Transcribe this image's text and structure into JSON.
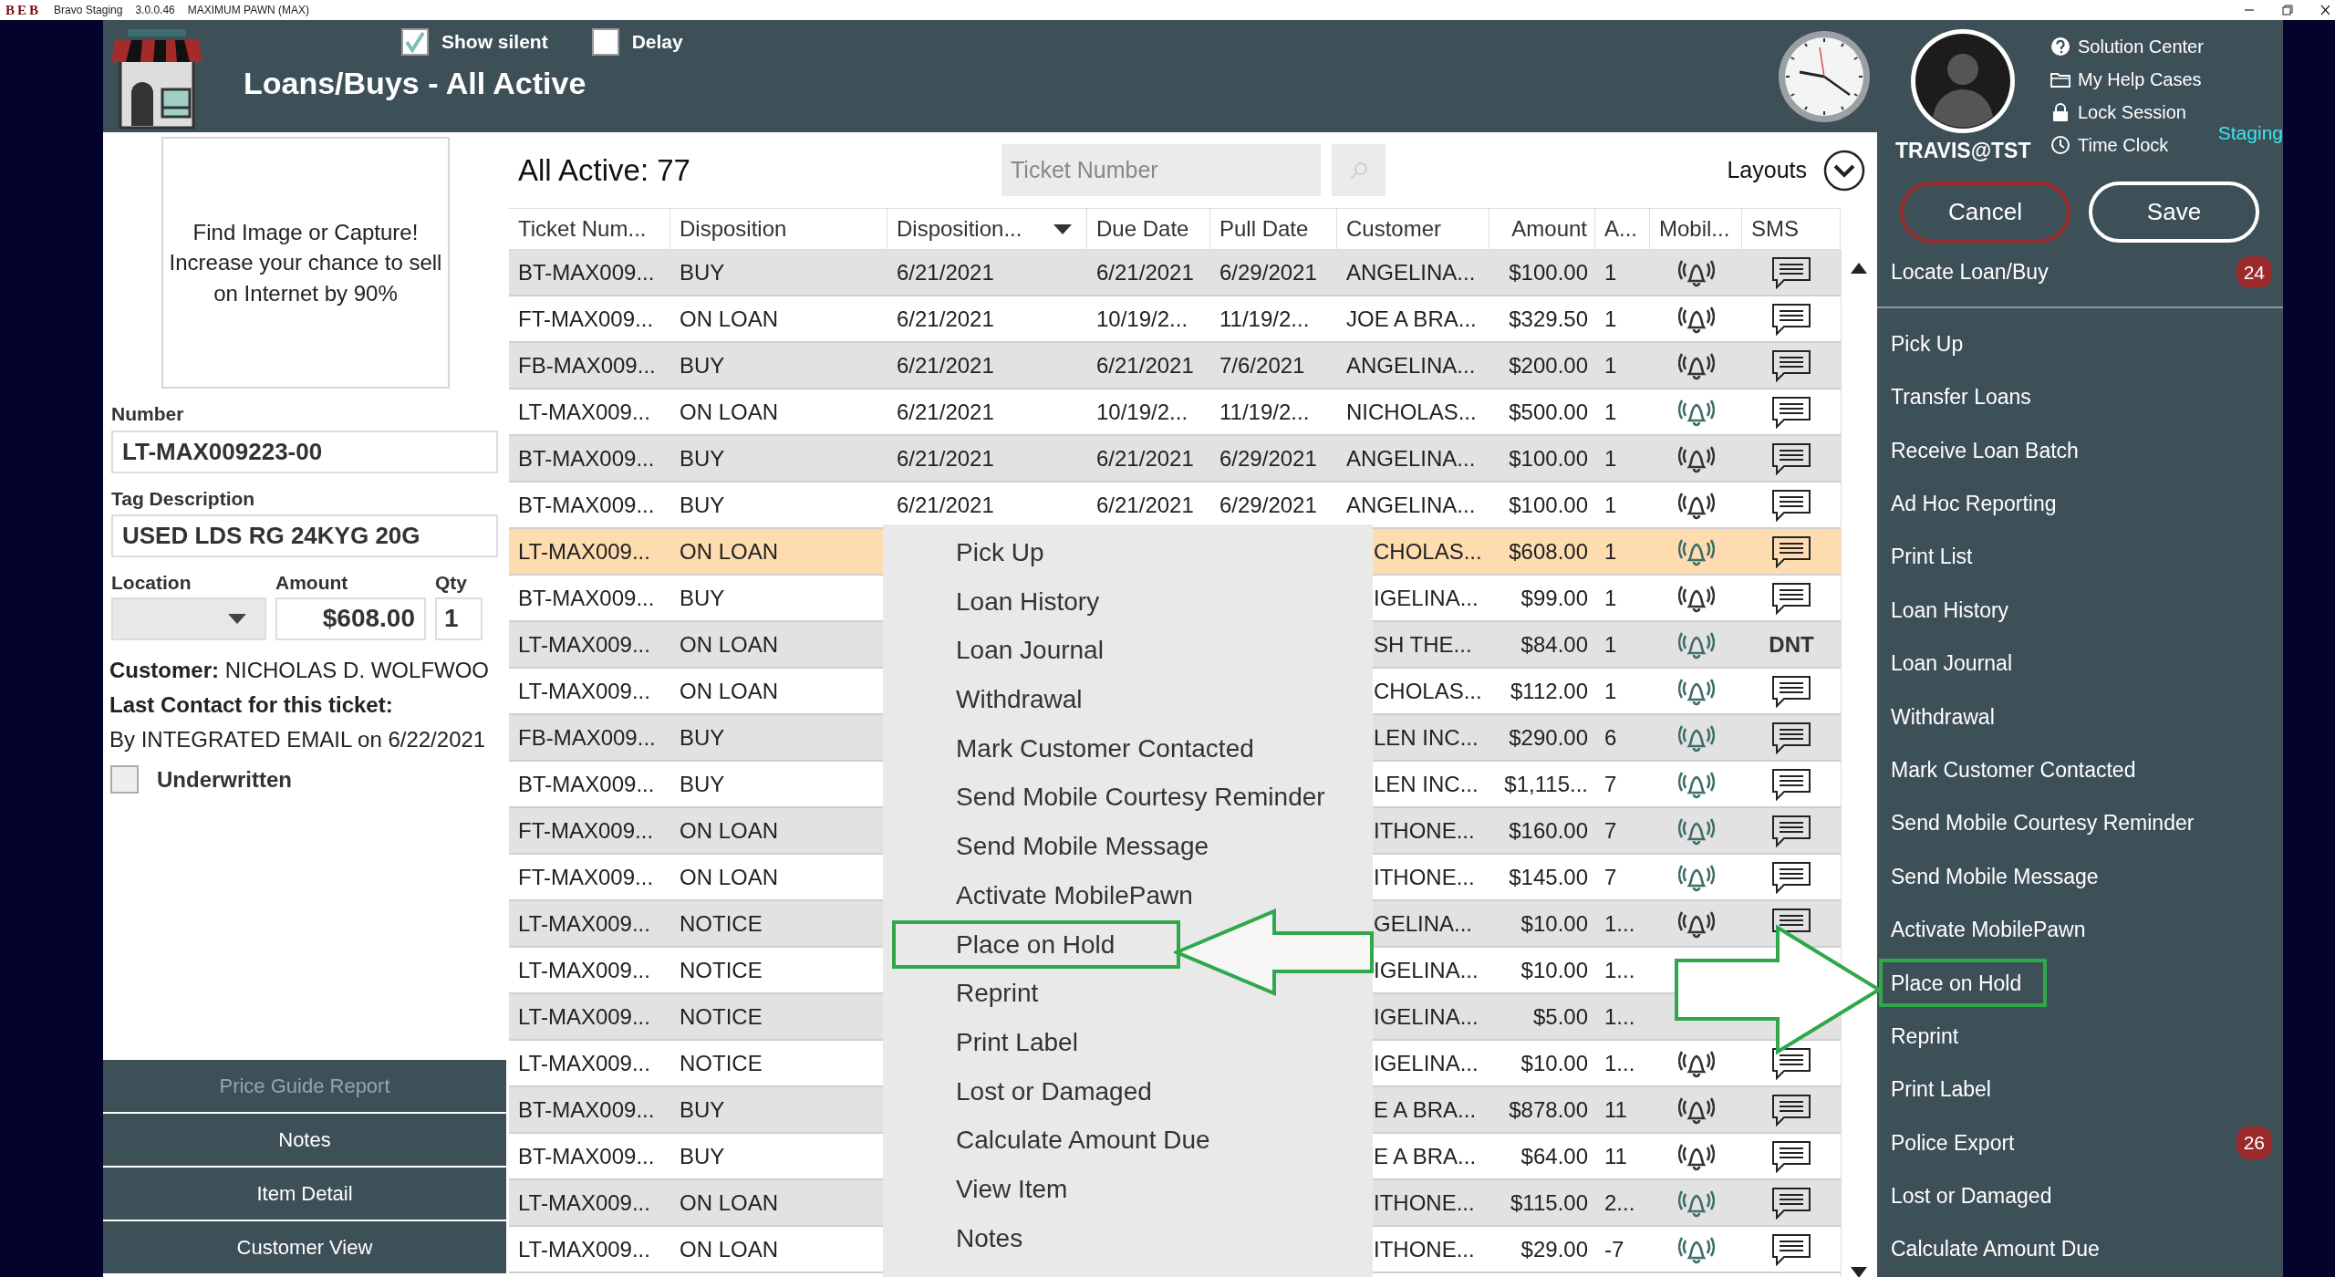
{
  "title_bar": {
    "logo": "BEB",
    "app": "Bravo Staging",
    "version": "3.0.0.46",
    "store": "MAXIMUM PAWN (MAX)"
  },
  "header": {
    "title": "Loans/Buys - All Active",
    "checkboxes": [
      {
        "label": "Show silent",
        "checked": true
      },
      {
        "label": "Delay",
        "checked": false
      }
    ]
  },
  "user": {
    "name": "TRAVIS@TST",
    "environment": "Staging",
    "links": [
      {
        "label": "Solution Center"
      },
      {
        "label": "My Help Cases"
      },
      {
        "label": "Lock Session"
      },
      {
        "label": "Time Clock"
      }
    ]
  },
  "detail": {
    "image_prompt": "Find Image or Capture!\nIncrease your chance to sell\non Internet by 90%",
    "number_label": "Number",
    "number": "LT-MAX009223-00",
    "tag_label": "Tag Description",
    "tag": "USED LDS RG 24KYG 20G",
    "location_label": "Location",
    "amount_label": "Amount",
    "amount": "$608.00",
    "qty_label": "Qty",
    "qty": "1",
    "customer": "**Customer:** NICHOLAS D. WOLFWOO",
    "last_contact_label": "Last Contact for this ticket:",
    "last_contact": "By INTEGRATED EMAIL on 6/22/2021",
    "underwritten": {
      "label": "Underwritten",
      "checked": false
    }
  },
  "detail_buttons": [
    {
      "label": "Price Guide Report",
      "disabled": true
    },
    {
      "label": "Notes",
      "disabled": false
    },
    {
      "label": "Item Detail",
      "disabled": false
    },
    {
      "label": "Customer View",
      "disabled": false
    }
  ],
  "list": {
    "title": "All Active: 77",
    "search_placeholder": "Ticket Number",
    "layouts_label": "Layouts"
  },
  "table": {
    "columns": [
      {
        "label": "Ticket Num..."
      },
      {
        "label": "Disposition"
      },
      {
        "label": "Disposition...",
        "sorted": true
      },
      {
        "label": "Due Date"
      },
      {
        "label": "Pull Date"
      },
      {
        "label": "Customer"
      },
      {
        "label": "Amount"
      },
      {
        "label": "A..."
      },
      {
        "label": "Mobil..."
      },
      {
        "label": "SMS"
      }
    ],
    "rows": [
      {
        "ticket": "BT-MAX009...",
        "disposition": "BUY",
        "disposition_date": "6/21/2021",
        "due_date": "6/21/2021",
        "pull_date": "6/29/2021",
        "customer": "ANGELINA...",
        "amount": "$100.00",
        "a": "1",
        "mobile": {
          "color": "#333333"
        },
        "sms": {
          "kind": "icon"
        },
        "selected": false
      },
      {
        "ticket": "FT-MAX009...",
        "disposition": "ON LOAN",
        "disposition_date": "6/21/2021",
        "due_date": "10/19/2...",
        "pull_date": "11/19/2...",
        "customer": "JOE A BRA...",
        "amount": "$329.50",
        "a": "1",
        "mobile": {
          "color": "#333333"
        },
        "sms": {
          "kind": "icon"
        },
        "selected": false
      },
      {
        "ticket": "FB-MAX009...",
        "disposition": "BUY",
        "disposition_date": "6/21/2021",
        "due_date": "6/21/2021",
        "pull_date": "7/6/2021",
        "customer": "ANGELINA...",
        "amount": "$200.00",
        "a": "1",
        "mobile": {
          "color": "#333333"
        },
        "sms": {
          "kind": "icon"
        },
        "selected": false
      },
      {
        "ticket": "LT-MAX009...",
        "disposition": "ON LOAN",
        "disposition_date": "6/21/2021",
        "due_date": "10/19/2...",
        "pull_date": "11/19/2...",
        "customer": "NICHOLAS...",
        "amount": "$500.00",
        "a": "1",
        "mobile": {
          "color": "#3e6e68"
        },
        "sms": {
          "kind": "icon"
        },
        "selected": false
      },
      {
        "ticket": "BT-MAX009...",
        "disposition": "BUY",
        "disposition_date": "6/21/2021",
        "due_date": "6/21/2021",
        "pull_date": "6/29/2021",
        "customer": "ANGELINA...",
        "amount": "$100.00",
        "a": "1",
        "mobile": {
          "color": "#333333"
        },
        "sms": {
          "kind": "icon"
        },
        "selected": false
      },
      {
        "ticket": "BT-MAX009...",
        "disposition": "BUY",
        "disposition_date": "6/21/2021",
        "due_date": "6/21/2021",
        "pull_date": "6/29/2021",
        "customer": "ANGELINA...",
        "amount": "$100.00",
        "a": "1",
        "mobile": {
          "color": "#333333"
        },
        "sms": {
          "kind": "icon"
        },
        "selected": false
      },
      {
        "ticket": "LT-MAX009...",
        "disposition": "ON LOAN",
        "customer": "CHOLAS...",
        "amount": "$608.00",
        "a": "1",
        "mobile": {
          "color": "#3e6e68"
        },
        "sms": {
          "kind": "icon"
        },
        "selected": true
      },
      {
        "ticket": "BT-MAX009...",
        "disposition": "BUY",
        "customer": "IGELINA...",
        "amount": "$99.00",
        "a": "1",
        "mobile": {
          "color": "#333333"
        },
        "sms": {
          "kind": "icon"
        },
        "selected": false
      },
      {
        "ticket": "LT-MAX009...",
        "disposition": "ON LOAN",
        "customer": "SH THE...",
        "amount": "$84.00",
        "a": "1",
        "mobile": {
          "color": "#3e6e68"
        },
        "sms": {
          "kind": "text",
          "text": "DNT"
        },
        "selected": false
      },
      {
        "ticket": "LT-MAX009...",
        "disposition": "ON LOAN",
        "customer": "CHOLAS...",
        "amount": "$112.00",
        "a": "1",
        "mobile": {
          "color": "#3e6e68"
        },
        "sms": {
          "kind": "icon"
        },
        "selected": false
      },
      {
        "ticket": "FB-MAX009...",
        "disposition": "BUY",
        "customer": "LEN INC...",
        "amount": "$290.00",
        "a": "6",
        "mobile": {
          "color": "#3e6e68"
        },
        "sms": {
          "kind": "icon"
        },
        "selected": false
      },
      {
        "ticket": "BT-MAX009...",
        "disposition": "BUY",
        "customer": "LEN INC...",
        "amount": "$1,115...",
        "a": "7",
        "mobile": {
          "color": "#3e6e68"
        },
        "sms": {
          "kind": "icon"
        },
        "selected": false
      },
      {
        "ticket": "FT-MAX009...",
        "disposition": "ON LOAN",
        "customer": "ITHONE...",
        "amount": "$160.00",
        "a": "7",
        "mobile": {
          "color": "#3e6e68"
        },
        "sms": {
          "kind": "icon"
        },
        "selected": false
      },
      {
        "ticket": "FT-MAX009...",
        "disposition": "ON LOAN",
        "customer": "ITHONE...",
        "amount": "$145.00",
        "a": "7",
        "mobile": {
          "color": "#3e6e68"
        },
        "sms": {
          "kind": "icon"
        },
        "selected": false
      },
      {
        "ticket": "LT-MAX009...",
        "disposition": "NOTICE",
        "customer": "GELINA...",
        "amount": "$10.00",
        "a": "1...",
        "mobile": {
          "color": "#333333"
        },
        "sms": {
          "kind": "icon"
        },
        "selected": false
      },
      {
        "ticket": "LT-MAX009...",
        "disposition": "NOTICE",
        "customer": "IGELINA...",
        "amount": "$10.00",
        "a": "1...",
        "selected": false
      },
      {
        "ticket": "LT-MAX009...",
        "disposition": "NOTICE",
        "customer": "IGELINA...",
        "amount": "$5.00",
        "a": "1...",
        "selected": false
      },
      {
        "ticket": "LT-MAX009...",
        "disposition": "NOTICE",
        "customer": "IGELINA...",
        "amount": "$10.00",
        "a": "1...",
        "mobile": {
          "color": "#333333"
        },
        "sms": {
          "kind": "icon"
        },
        "selected": false
      },
      {
        "ticket": "BT-MAX009...",
        "disposition": "BUY",
        "customer": "E A BRA...",
        "amount": "$878.00",
        "a": "11",
        "mobile": {
          "color": "#333333"
        },
        "sms": {
          "kind": "icon"
        },
        "selected": false
      },
      {
        "ticket": "BT-MAX009...",
        "disposition": "BUY",
        "customer": "E A BRA...",
        "amount": "$64.00",
        "a": "11",
        "mobile": {
          "color": "#333333"
        },
        "sms": {
          "kind": "icon"
        },
        "selected": false
      },
      {
        "ticket": "LT-MAX009...",
        "disposition": "ON LOAN",
        "customer": "ITHONE...",
        "amount": "$115.00",
        "a": "2...",
        "mobile": {
          "color": "#3e6e68"
        },
        "sms": {
          "kind": "icon"
        },
        "selected": false
      },
      {
        "ticket": "LT-MAX009...",
        "disposition": "ON LOAN",
        "customer": "ITHONE...",
        "amount": "$29.00",
        "a": "-7",
        "mobile": {
          "color": "#3e6e68"
        },
        "sms": {
          "kind": "icon"
        },
        "selected": false
      }
    ]
  },
  "context_menu": [
    {
      "label": "Pick Up",
      "annotated": false
    },
    {
      "label": "Loan History",
      "annotated": false
    },
    {
      "label": "Loan Journal",
      "annotated": false
    },
    {
      "label": "Withdrawal",
      "annotated": false
    },
    {
      "label": "Mark Customer Contacted",
      "annotated": false
    },
    {
      "label": "Send Mobile Courtesy Reminder",
      "annotated": false
    },
    {
      "label": "Send Mobile Message",
      "annotated": false
    },
    {
      "label": "Activate MobilePawn",
      "annotated": false
    },
    {
      "label": "Place on Hold",
      "annotated": true
    },
    {
      "label": "Reprint",
      "annotated": false
    },
    {
      "label": "Print Label",
      "annotated": false
    },
    {
      "label": "Lost or Damaged",
      "annotated": false
    },
    {
      "label": "Calculate Amount Due",
      "annotated": false
    },
    {
      "label": "View Item",
      "annotated": false
    },
    {
      "label": "Notes",
      "annotated": false
    }
  ],
  "callout_arrows": [
    {
      "kind": "left"
    },
    {
      "kind": "right"
    }
  ],
  "sidebar": {
    "cancel": "Cancel",
    "save": "Save",
    "locate": {
      "label": "Locate Loan/Buy",
      "badge": "24"
    },
    "items": [
      {
        "label": "Pick Up",
        "annotated": false
      },
      {
        "label": "Transfer Loans",
        "annotated": false
      },
      {
        "label": "Receive Loan Batch",
        "annotated": false
      },
      {
        "label": "Ad Hoc Reporting",
        "annotated": false
      },
      {
        "label": "Print List",
        "annotated": false
      },
      {
        "label": "Loan History",
        "annotated": false
      },
      {
        "label": "Loan Journal",
        "annotated": false
      },
      {
        "label": "Withdrawal",
        "annotated": false
      },
      {
        "label": "Mark Customer Contacted",
        "annotated": false
      },
      {
        "label": "Send Mobile Courtesy Reminder",
        "annotated": false
      },
      {
        "label": "Send Mobile Message",
        "annotated": false
      },
      {
        "label": "Activate MobilePawn",
        "annotated": false
      },
      {
        "label": "Place on Hold",
        "annotated": true
      },
      {
        "label": "Reprint",
        "annotated": false
      },
      {
        "label": "Print Label",
        "annotated": false
      },
      {
        "label": "Police Export",
        "annotated": false,
        "badge": "26"
      },
      {
        "label": "Lost or Damaged",
        "annotated": false
      },
      {
        "label": "Calculate Amount Due",
        "annotated": false
      }
    ]
  }
}
